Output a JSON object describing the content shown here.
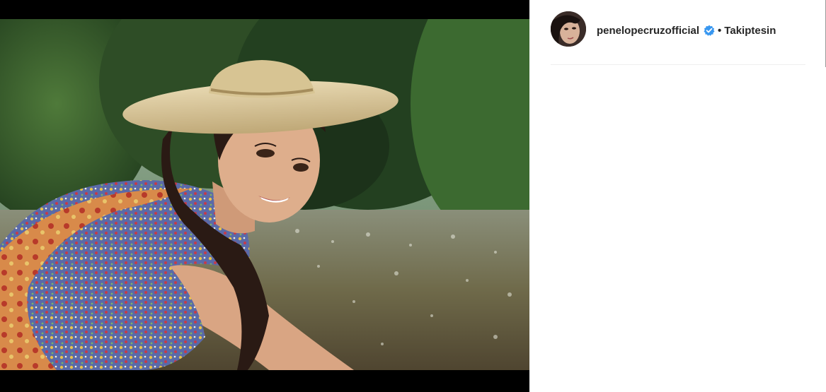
{
  "post": {
    "image_alt": "Woman in straw hat and floral dress smiling by a river"
  },
  "header": {
    "username": "penelopecruzofficial",
    "verified_icon": "verified-badge-icon",
    "separator": "•",
    "follow_status": "Takiptesin"
  },
  "colors": {
    "verified_blue": "#3897f0",
    "text": "#262626",
    "divider": "#efefef"
  }
}
